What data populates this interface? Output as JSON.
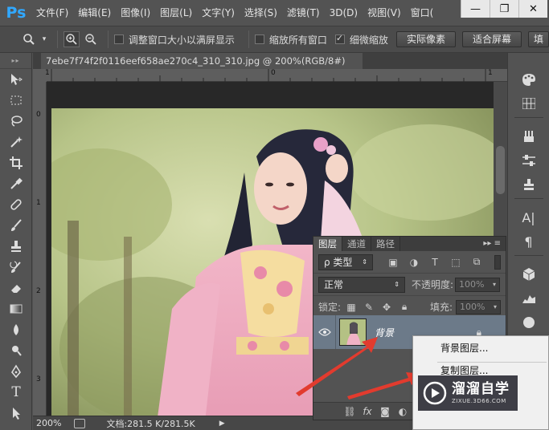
{
  "app": {
    "logo": "Ps"
  },
  "menubar": {
    "items": [
      "文件(F)",
      "编辑(E)",
      "图像(I)",
      "图层(L)",
      "文字(Y)",
      "选择(S)",
      "滤镜(T)",
      "3D(D)",
      "视图(V)",
      "窗口("
    ],
    "window_controls": {
      "minimize": "—",
      "restore": "❐",
      "close": "✕"
    }
  },
  "options_bar": {
    "tool_icon": "zoom-icon",
    "zoom_in_icon": "zoom-in-icon",
    "zoom_out_icon": "zoom-out-icon",
    "checkboxes": [
      {
        "label": "调整窗口大小以满屏显示",
        "checked": false
      },
      {
        "label": "缩放所有窗口",
        "checked": false
      },
      {
        "label": "细微缩放",
        "checked": true
      }
    ],
    "buttons": [
      "实际像素",
      "适合屏幕",
      "填"
    ]
  },
  "document": {
    "tab_title": "7ebe7f74f2f0116eef658ae270c4_310_310.jpg @ 200%(RGB/8#)",
    "ruler_top_labels": [
      "1",
      "0",
      "1"
    ],
    "ruler_left_labels": [
      "0",
      "1",
      "2",
      "3"
    ]
  },
  "status_bar": {
    "zoom": "200%",
    "doc_info": "文档:281.5 K/281.5K"
  },
  "layers_panel": {
    "tabs": [
      "图层",
      "通道",
      "路径"
    ],
    "active_tab": "图层",
    "filter_kind": "ρ 类型",
    "blend_mode": "正常",
    "opacity_label": "不透明度:",
    "opacity_value": "100%",
    "lock_label": "锁定:",
    "fill_label": "填充:",
    "fill_value": "100%",
    "layer": {
      "name": "背景"
    },
    "footer_fx": "fx"
  },
  "context_menu": {
    "items": [
      "背景图层...",
      "复制图层..."
    ]
  },
  "watermark": {
    "title": "溜溜自学",
    "subtitle": "ZIXUE.3D66.COM"
  },
  "colors": {
    "ui_bg": "#535353",
    "ps_blue": "#31a8ff",
    "selected_layer": "#6c7a89",
    "arrow_red": "#e23b2e"
  }
}
